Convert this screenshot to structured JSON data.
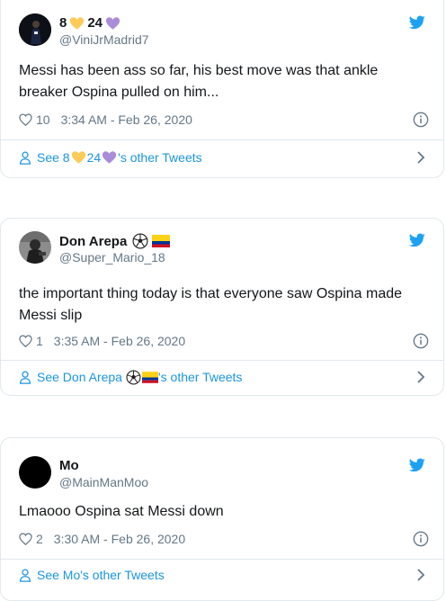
{
  "tweets": [
    {
      "name_part1": "8",
      "name_part2": "24",
      "handle": "@ViniJrMadrid7",
      "text": "Messi has been ass so far, his best move was that ankle breaker Ospina pulled on him...",
      "likes": "10",
      "timestamp": "3:34 AM - Feb 26, 2020",
      "footer_prefix": "See 8",
      "footer_mid": "24",
      "footer_suffix": "'s other Tweets"
    },
    {
      "name": "Don Arepa",
      "handle": "@Super_Mario_18",
      "text": "the important thing today is that everyone saw Ospina made Messi slip",
      "likes": "1",
      "timestamp": "3:35 AM - Feb 26, 2020",
      "footer_prefix": "See Don Arepa",
      "footer_suffix": "'s other Tweets"
    },
    {
      "name": "Mo",
      "handle": "@MainManMoo",
      "text": "Lmaooo Ospina sat Messi down",
      "likes": "2",
      "timestamp": "3:30 AM - Feb 26, 2020",
      "footer": "See Mo's other Tweets"
    }
  ],
  "colors": {
    "link": "#1b95e0",
    "muted": "#657786",
    "border": "#e1e8ed",
    "twitter_blue": "#1da1f2"
  },
  "icons": [
    "twitter-bird-icon",
    "heart-icon",
    "info-icon",
    "person-icon",
    "chevron-right-icon",
    "yellow-heart-emoji",
    "purple-heart-emoji",
    "soccer-ball-emoji",
    "colombia-flag-emoji"
  ]
}
